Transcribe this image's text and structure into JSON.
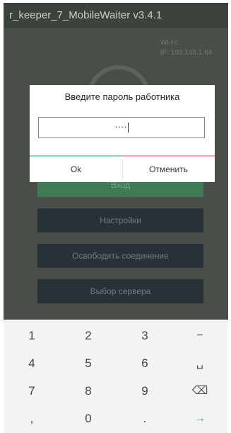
{
  "app": {
    "title": "r_keeper_7_MobileWaiter v3.4.1",
    "wifi_label": "Wi-Fi:",
    "ip_line": "IP: 192.168.1.64"
  },
  "dialog": {
    "title": "Введите пароль работника",
    "pin_value": "····",
    "ok_label": "Ok",
    "cancel_label": "Отменить"
  },
  "buttons": {
    "enter": "Вход",
    "settings": "Настройки",
    "release": "Освободить соединение",
    "server": "Выбор сервера"
  },
  "keypad": {
    "r1": [
      "1",
      "2",
      "3",
      "−"
    ],
    "r2": [
      "4",
      "5",
      "6",
      "␣"
    ],
    "r3": [
      "7",
      "8",
      "9",
      "⌫"
    ],
    "r4": [
      ",",
      "0",
      ".",
      "→"
    ]
  },
  "colors": {
    "accent_green": "#3f7a55",
    "dialog_left_line": "#8ad3c2",
    "dialog_right_line": "#f2a4a4",
    "enter_key": "#2f8fcf"
  }
}
